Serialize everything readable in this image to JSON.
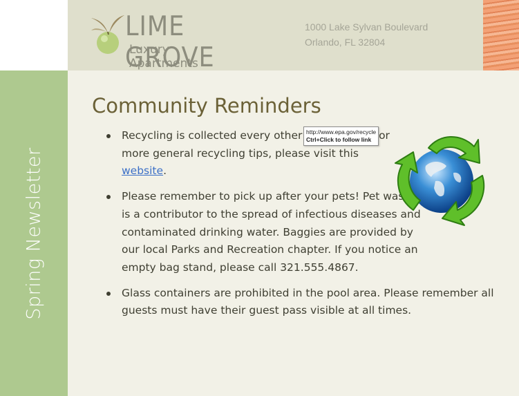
{
  "brand": {
    "name": "LIME GROVE",
    "tagline": "Luxury Apartments"
  },
  "address": {
    "line1": "1000 Lake Sylvan Boulevard",
    "line2": "Orlando, FL 32804"
  },
  "sidebar": {
    "label": "Spring Newsletter"
  },
  "main": {
    "title": "Community Reminders",
    "items": [
      {
        "text_before": "Recycling is collected every other Wednesday. For more general recycling tips, please visit this ",
        "link_text": "website",
        "text_after": "."
      },
      {
        "text": "Please remember to pick up after your pets! Pet waste is a contributor to the spread of infectious diseases and contaminated drinking water. Baggies are provided by our local Parks and Recreation chapter. If you notice an empty bag stand, please call 321.555.4867."
      },
      {
        "text": "Glass containers are prohibited in the pool area. Please remember all guests must have their guest pass visible at all times."
      }
    ]
  },
  "tooltip": {
    "url": "http://www.epa.gov/recycle",
    "hint": "Ctrl+Click to follow link"
  },
  "colors": {
    "header_band": "#dfdfcc",
    "sidebar": "#aec98f",
    "page_bg": "#f2f1e7",
    "title": "#6b6137",
    "link": "#3b6fc7"
  },
  "icons": [
    "lime-logo-icon",
    "recycle-globe-icon"
  ]
}
